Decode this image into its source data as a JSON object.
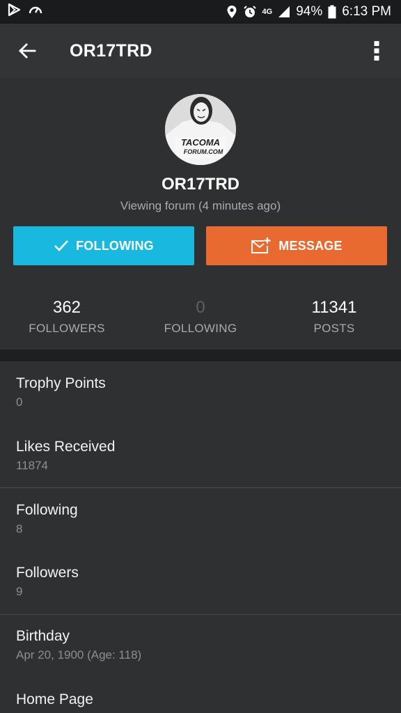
{
  "status_bar": {
    "network": "4G",
    "battery": "94%",
    "time": "6:13 PM"
  },
  "app_bar": {
    "title": "OR17TRD"
  },
  "profile": {
    "username": "OR17TRD",
    "presence": "Viewing forum (4 minutes ago)",
    "avatar_text": [
      "TACOMA",
      "FORUM.COM"
    ],
    "follow_button": "FOLLOWING",
    "message_button": "MESSAGE",
    "stats": [
      {
        "value": "362",
        "label": "FOLLOWERS"
      },
      {
        "value": "0",
        "label": "FOLLOWING"
      },
      {
        "value": "11341",
        "label": "POSTS"
      }
    ]
  },
  "info": [
    {
      "label": "Trophy Points",
      "value": "0"
    },
    {
      "label": "Likes Received",
      "value": "11874"
    },
    {
      "label": "Following",
      "value": "8"
    },
    {
      "label": "Followers",
      "value": "9"
    },
    {
      "label": "Birthday",
      "value": "Apr 20, 1900 (Age: 118)"
    },
    {
      "label": "Home Page",
      "value": ""
    }
  ],
  "colors": {
    "follow_button": "#19b8df",
    "message_button": "#e96a30",
    "background": "#2f3032"
  }
}
